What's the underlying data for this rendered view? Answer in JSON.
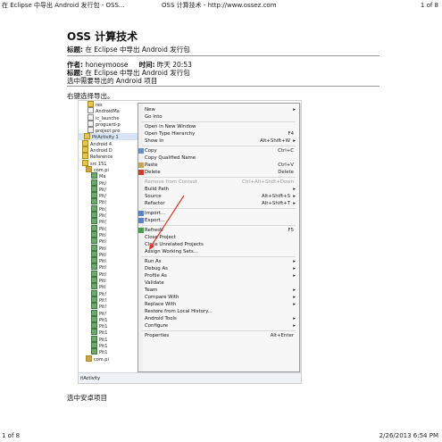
{
  "browser_header": {
    "left": "在 Eclipse 中导出 Android 发行包 - OSS...",
    "center": "OSS 计算技术 - http://www.ossez.com",
    "right": "1 of 8"
  },
  "browser_footer": {
    "left": "1 of 8",
    "right": "2/26/2013 6:54 PM"
  },
  "article": {
    "site_title": "OSS 计算技术",
    "title_label": "标题:",
    "title_value": "在 Eclipse 中导出 Android 发行包",
    "author_label": "作者:",
    "author_value": "honeymoose",
    "time_label": "时间:",
    "time_value": "昨天 20:53",
    "title2_label": "标题:",
    "title2_value": "在 Eclipse 中导出 Android 发行包",
    "body_line": "选中需要导出的 Android 项目",
    "step1": "右键选择导出。",
    "step2": "选中安卓项目"
  },
  "screenshot": {
    "tree_rows": [
      {
        "label": "res",
        "kind": "folder"
      },
      {
        "label": "AndroidMa",
        "kind": "file"
      },
      {
        "label": "ic_launche",
        "kind": "file"
      },
      {
        "label": "proguard-p",
        "kind": "file"
      },
      {
        "label": "project.pro",
        "kind": "file"
      },
      {
        "label": "PitActivity 1",
        "kind": "folder",
        "selected": true
      },
      {
        "label": "Android 4.",
        "kind": "folder"
      },
      {
        "label": "Android D",
        "kind": "folder"
      },
      {
        "label": "Reference",
        "kind": "folder"
      },
      {
        "label": "src 151",
        "kind": "folder"
      },
      {
        "label": "com.pi",
        "kind": "pkg"
      },
      {
        "label": "Ma",
        "kind": "java"
      },
      {
        "label": "Pit/",
        "kind": "java"
      },
      {
        "label": "Pit/",
        "kind": "java"
      },
      {
        "label": "Pit/",
        "kind": "java"
      },
      {
        "label": "Pit(",
        "kind": "java"
      },
      {
        "label": "Pit(",
        "kind": "java"
      },
      {
        "label": "Pit(",
        "kind": "java"
      },
      {
        "label": "Pit(",
        "kind": "java"
      },
      {
        "label": "Pit(",
        "kind": "java"
      },
      {
        "label": "PitI",
        "kind": "java"
      },
      {
        "label": "PitI",
        "kind": "java"
      },
      {
        "label": "PitI",
        "kind": "java"
      },
      {
        "label": "PitI",
        "kind": "java"
      },
      {
        "label": "PitI",
        "kind": "java"
      },
      {
        "label": "PitI",
        "kind": "java"
      },
      {
        "label": "PitI",
        "kind": "java"
      },
      {
        "label": "Pitl",
        "kind": "java"
      },
      {
        "label": "Pitl",
        "kind": "java"
      },
      {
        "label": "Pit!",
        "kind": "java"
      },
      {
        "label": "Pit!",
        "kind": "java"
      },
      {
        "label": "Pit!",
        "kind": "java"
      },
      {
        "label": "Pit!",
        "kind": "java"
      },
      {
        "label": "Pit1",
        "kind": "java"
      },
      {
        "label": "Pit1",
        "kind": "java"
      },
      {
        "label": "Pit1",
        "kind": "java"
      },
      {
        "label": "Pit1",
        "kind": "java"
      },
      {
        "label": "Pit1",
        "kind": "java"
      },
      {
        "label": "Pit1",
        "kind": "java"
      },
      {
        "label": "com.pi",
        "kind": "pkg"
      }
    ],
    "status_text": "itActivity",
    "menu": [
      {
        "label": "New",
        "shortcut": "",
        "submenu": true
      },
      {
        "label": "Go Into",
        "shortcut": ""
      },
      {
        "sep": true
      },
      {
        "label": "Open in New Window",
        "shortcut": ""
      },
      {
        "label": "Open Type Hierarchy",
        "shortcut": "F4"
      },
      {
        "label": "Show In",
        "shortcut": "Alt+Shift+W",
        "submenu": true
      },
      {
        "sep": true
      },
      {
        "label": "Copy",
        "shortcut": "Ctrl+C",
        "icon": "copy"
      },
      {
        "label": "Copy Qualified Name",
        "shortcut": ""
      },
      {
        "label": "Paste",
        "shortcut": "Ctrl+V",
        "icon": "paste"
      },
      {
        "label": "Delete",
        "shortcut": "Delete",
        "icon": "delete"
      },
      {
        "sep": true
      },
      {
        "label": "Remove from Context",
        "shortcut": "Ctrl+Alt+Shift+Down",
        "disabled": true
      },
      {
        "label": "Build Path",
        "shortcut": "",
        "submenu": true
      },
      {
        "label": "Source",
        "shortcut": "Alt+Shift+S",
        "submenu": true
      },
      {
        "label": "Refactor",
        "shortcut": "Alt+Shift+T",
        "submenu": true
      },
      {
        "sep": true
      },
      {
        "label": "Import...",
        "shortcut": "",
        "icon": "import"
      },
      {
        "label": "Export...",
        "shortcut": "",
        "icon": "export"
      },
      {
        "sep": true
      },
      {
        "label": "Refresh",
        "shortcut": "F5",
        "icon": "refresh"
      },
      {
        "label": "Close Project",
        "shortcut": ""
      },
      {
        "label": "Close Unrelated Projects",
        "shortcut": ""
      },
      {
        "label": "Assign Working Sets...",
        "shortcut": ""
      },
      {
        "sep": true
      },
      {
        "label": "Run As",
        "shortcut": "",
        "submenu": true
      },
      {
        "label": "Debug As",
        "shortcut": "",
        "submenu": true
      },
      {
        "label": "Profile As",
        "shortcut": "",
        "submenu": true
      },
      {
        "label": "Validate",
        "shortcut": ""
      },
      {
        "label": "Team",
        "shortcut": "",
        "submenu": true
      },
      {
        "label": "Compare With",
        "shortcut": "",
        "submenu": true
      },
      {
        "label": "Replace With",
        "shortcut": "",
        "submenu": true
      },
      {
        "label": "Restore from Local History...",
        "shortcut": ""
      },
      {
        "label": "Android Tools",
        "shortcut": "",
        "submenu": true
      },
      {
        "label": "Configure",
        "shortcut": "",
        "submenu": true
      },
      {
        "sep": true
      },
      {
        "label": "Properties",
        "shortcut": "Alt+Enter"
      }
    ],
    "arrow_color": "#d9342b"
  }
}
